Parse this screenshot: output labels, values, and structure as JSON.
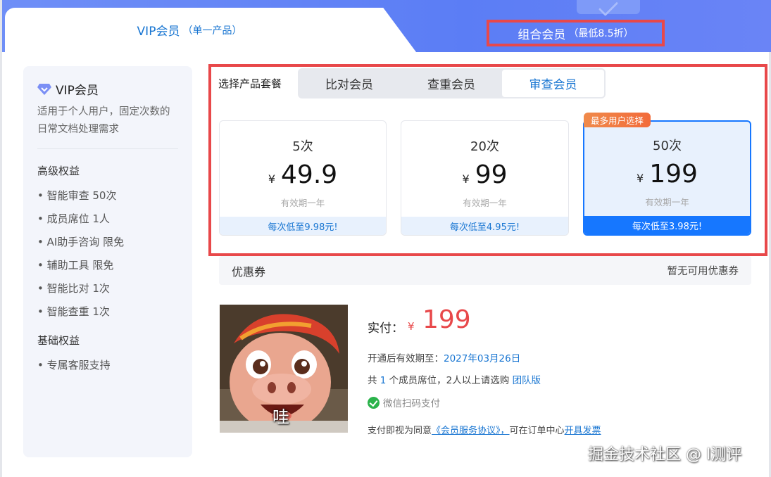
{
  "tabs": {
    "vip": {
      "label": "VIP会员",
      "sub": "（单一产品）"
    },
    "combo": {
      "label": "组合会员",
      "sub": "（最低8.5折）"
    }
  },
  "left_panel": {
    "title": "VIP会员",
    "description": "适用于个人用户，固定次数的日常文档处理需求",
    "advanced_title": "高级权益",
    "advanced_items": [
      "• 智能审查 50次",
      "• 成员席位 1人",
      "• AI助手咨询 限免",
      "• 辅助工具 限免",
      "• 智能比对 1次",
      "• 智能查重 1次"
    ],
    "basic_title": "基础权益",
    "basic_items": [
      "• 专属客服支持"
    ]
  },
  "products": {
    "select_label": "选择产品套餐",
    "segments": [
      "比对会员",
      "查重会员",
      "审查会员"
    ],
    "selected_segment": "审查会员",
    "badge": "最多用户选择",
    "plans": [
      {
        "count": "5次",
        "currency": "¥",
        "price": "49.9",
        "validity": "有效期一年",
        "foot": "每次低至9.98元!"
      },
      {
        "count": "20次",
        "currency": "¥",
        "price": "99",
        "validity": "有效期一年",
        "foot": "每次低至4.95元!"
      },
      {
        "count": "50次",
        "currency": "¥",
        "price": "199",
        "validity": "有效期一年",
        "foot": "每次低至3.98元!"
      }
    ]
  },
  "coupon": {
    "title": "优惠券",
    "status": "暂无可用优惠券"
  },
  "payment": {
    "image_caption": "哇",
    "actual_label": "实付：",
    "currency": "¥",
    "amount": "199",
    "validity_prefix": "开通后有效期至：",
    "validity_date": "2027年03月26日",
    "seats_prefix": "共 ",
    "seats_count": "1",
    "seats_suffix": " 个成员席位，2人以上请选购 ",
    "team_link": "团队版",
    "wechat_text": "微信扫码支付",
    "agree_prefix": "支付即视为同意",
    "agreement_link": "《会员服务协议》，",
    "agree_middle": "可在订单中心",
    "invoice_link": "开具发票"
  },
  "watermark": "掘金技术社区 @ I测评",
  "colors": {
    "header_blue": "#5b7df5",
    "accent_blue": "#1677ff",
    "text_blue": "#1976d2",
    "highlight_red": "#e8484a",
    "badge_orange": "#f26b3a",
    "wechat_green": "#2bb34b"
  }
}
